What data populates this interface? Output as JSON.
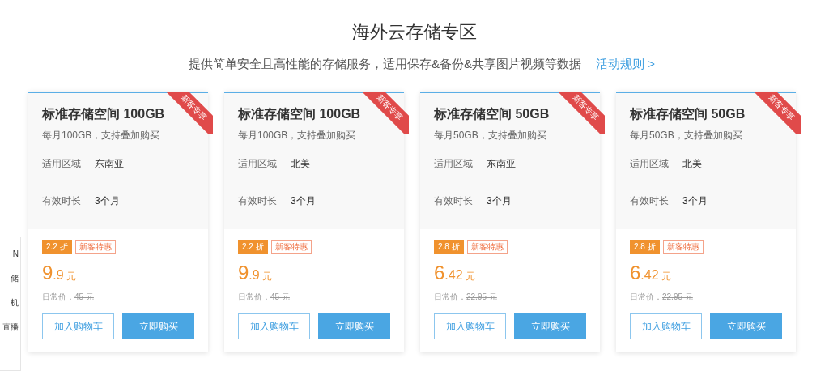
{
  "header": {
    "title": "海外云存储专区",
    "subtitle": "提供简单安全且高性能的存储服务，适用保存&备份&共享图片视频等数据",
    "link": "活动规则 >"
  },
  "side_menu": [
    "N",
    "储",
    "机",
    "直播"
  ],
  "cards": [
    {
      "ribbon": "新客专享",
      "title": "标准存储空间 100GB",
      "desc": "每月100GB，支持叠加购买",
      "rows": [
        {
          "label": "适用区域",
          "value": "东南亚"
        },
        {
          "label": "有效时长",
          "value": "3个月"
        }
      ],
      "discount": "2.2 折",
      "tag": "新客特惠",
      "price": "9.9",
      "unit": "元",
      "regular_label": "日常价：",
      "regular_price": "45 元",
      "cart_button": "加入购物车",
      "buy_button": "立即购买"
    },
    {
      "ribbon": "新客专享",
      "title": "标准存储空间 100GB",
      "desc": "每月100GB，支持叠加购买",
      "rows": [
        {
          "label": "适用区域",
          "value": "北美"
        },
        {
          "label": "有效时长",
          "value": "3个月"
        }
      ],
      "discount": "2.2 折",
      "tag": "新客特惠",
      "price": "9.9",
      "unit": "元",
      "regular_label": "日常价：",
      "regular_price": "45 元",
      "cart_button": "加入购物车",
      "buy_button": "立即购买"
    },
    {
      "ribbon": "新客专享",
      "title": "标准存储空间 50GB",
      "desc": "每月50GB，支持叠加购买",
      "rows": [
        {
          "label": "适用区域",
          "value": "东南亚"
        },
        {
          "label": "有效时长",
          "value": "3个月"
        }
      ],
      "discount": "2.8 折",
      "tag": "新客特惠",
      "price": "6.42",
      "unit": "元",
      "regular_label": "日常价：",
      "regular_price": "22.95 元",
      "cart_button": "加入购物车",
      "buy_button": "立即购买"
    },
    {
      "ribbon": "新客专享",
      "title": "标准存储空间 50GB",
      "desc": "每月50GB，支持叠加购买",
      "rows": [
        {
          "label": "适用区域",
          "value": "北美"
        },
        {
          "label": "有效时长",
          "value": "3个月"
        }
      ],
      "discount": "2.8 折",
      "tag": "新客特惠",
      "price": "6.42",
      "unit": "元",
      "regular_label": "日常价：",
      "regular_price": "22.95 元",
      "cart_button": "加入购物车",
      "buy_button": "立即购买"
    }
  ]
}
